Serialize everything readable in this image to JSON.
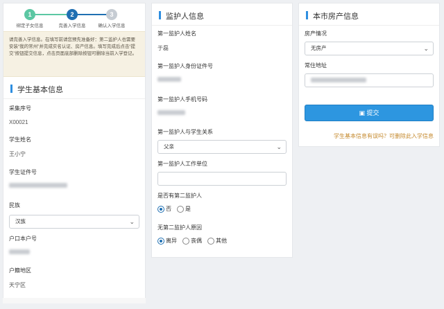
{
  "stepper": {
    "steps": [
      {
        "num": "1",
        "label": "绑定子女信息"
      },
      {
        "num": "2",
        "label": "完善入学信息"
      },
      {
        "num": "3",
        "label": "确认入学信息"
      }
    ]
  },
  "notice": "请完善入学信息。在填写前请您预先准备好：第二监护人也需要安装“我的常州”并完成实名认证、房产信息。填写完成后点击“提交”按钮提交信息，点击页面底部删除按钮可删除当前入学登记。",
  "student": {
    "title": "学生基本信息",
    "serial_label": "采集序号",
    "serial_value": "X00021",
    "name_label": "学生姓名",
    "name_value": "王小宁",
    "id_label": "学生证件号",
    "ethnic_label": "民族",
    "ethnic_value": "汉族",
    "hukou_label": "户口本户号",
    "region_label": "户籍地区",
    "region_value": "天宁区"
  },
  "guardian": {
    "title": "监护人信息",
    "name_label": "第一监护人姓名",
    "name_value": "于磊",
    "id_label": "第一监护人身份证件号",
    "phone_label": "第一监护人手机号码",
    "relation_label": "第一监护人与学生关系",
    "relation_value": "父亲",
    "work_label": "第一监护人工作单位",
    "work_value": "",
    "second_label": "是否有第二监护人",
    "second_options": [
      "否",
      "是"
    ],
    "reason_label": "无第二监护人原因",
    "reason_options": [
      "离异",
      "丧偶",
      "其他"
    ]
  },
  "house": {
    "title": "本市房产信息",
    "status_label": "房产情况",
    "status_value": "无房产",
    "address_label": "常住地址",
    "submit_label": "提交",
    "delete_link": "学生基本信息有误吗？可删除此入学信息"
  }
}
